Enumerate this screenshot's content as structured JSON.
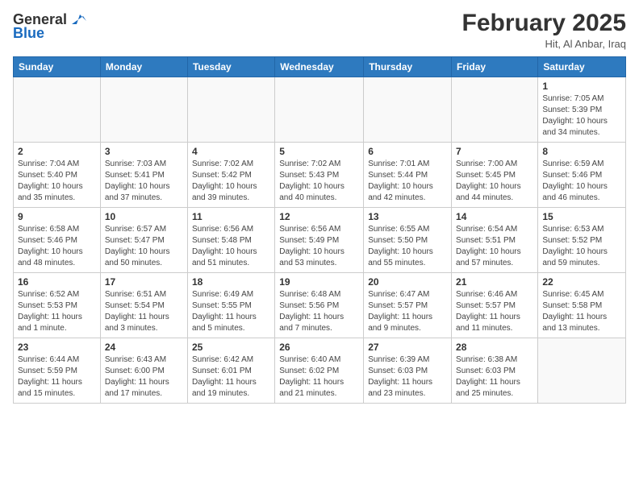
{
  "logo": {
    "general": "General",
    "blue": "Blue"
  },
  "header": {
    "month_year": "February 2025",
    "location": "Hit, Al Anbar, Iraq"
  },
  "weekdays": [
    "Sunday",
    "Monday",
    "Tuesday",
    "Wednesday",
    "Thursday",
    "Friday",
    "Saturday"
  ],
  "weeks": [
    [
      {
        "day": "",
        "info": ""
      },
      {
        "day": "",
        "info": ""
      },
      {
        "day": "",
        "info": ""
      },
      {
        "day": "",
        "info": ""
      },
      {
        "day": "",
        "info": ""
      },
      {
        "day": "",
        "info": ""
      },
      {
        "day": "1",
        "info": "Sunrise: 7:05 AM\nSunset: 5:39 PM\nDaylight: 10 hours and 34 minutes."
      }
    ],
    [
      {
        "day": "2",
        "info": "Sunrise: 7:04 AM\nSunset: 5:40 PM\nDaylight: 10 hours and 35 minutes."
      },
      {
        "day": "3",
        "info": "Sunrise: 7:03 AM\nSunset: 5:41 PM\nDaylight: 10 hours and 37 minutes."
      },
      {
        "day": "4",
        "info": "Sunrise: 7:02 AM\nSunset: 5:42 PM\nDaylight: 10 hours and 39 minutes."
      },
      {
        "day": "5",
        "info": "Sunrise: 7:02 AM\nSunset: 5:43 PM\nDaylight: 10 hours and 40 minutes."
      },
      {
        "day": "6",
        "info": "Sunrise: 7:01 AM\nSunset: 5:44 PM\nDaylight: 10 hours and 42 minutes."
      },
      {
        "day": "7",
        "info": "Sunrise: 7:00 AM\nSunset: 5:45 PM\nDaylight: 10 hours and 44 minutes."
      },
      {
        "day": "8",
        "info": "Sunrise: 6:59 AM\nSunset: 5:46 PM\nDaylight: 10 hours and 46 minutes."
      }
    ],
    [
      {
        "day": "9",
        "info": "Sunrise: 6:58 AM\nSunset: 5:46 PM\nDaylight: 10 hours and 48 minutes."
      },
      {
        "day": "10",
        "info": "Sunrise: 6:57 AM\nSunset: 5:47 PM\nDaylight: 10 hours and 50 minutes."
      },
      {
        "day": "11",
        "info": "Sunrise: 6:56 AM\nSunset: 5:48 PM\nDaylight: 10 hours and 51 minutes."
      },
      {
        "day": "12",
        "info": "Sunrise: 6:56 AM\nSunset: 5:49 PM\nDaylight: 10 hours and 53 minutes."
      },
      {
        "day": "13",
        "info": "Sunrise: 6:55 AM\nSunset: 5:50 PM\nDaylight: 10 hours and 55 minutes."
      },
      {
        "day": "14",
        "info": "Sunrise: 6:54 AM\nSunset: 5:51 PM\nDaylight: 10 hours and 57 minutes."
      },
      {
        "day": "15",
        "info": "Sunrise: 6:53 AM\nSunset: 5:52 PM\nDaylight: 10 hours and 59 minutes."
      }
    ],
    [
      {
        "day": "16",
        "info": "Sunrise: 6:52 AM\nSunset: 5:53 PM\nDaylight: 11 hours and 1 minute."
      },
      {
        "day": "17",
        "info": "Sunrise: 6:51 AM\nSunset: 5:54 PM\nDaylight: 11 hours and 3 minutes."
      },
      {
        "day": "18",
        "info": "Sunrise: 6:49 AM\nSunset: 5:55 PM\nDaylight: 11 hours and 5 minutes."
      },
      {
        "day": "19",
        "info": "Sunrise: 6:48 AM\nSunset: 5:56 PM\nDaylight: 11 hours and 7 minutes."
      },
      {
        "day": "20",
        "info": "Sunrise: 6:47 AM\nSunset: 5:57 PM\nDaylight: 11 hours and 9 minutes."
      },
      {
        "day": "21",
        "info": "Sunrise: 6:46 AM\nSunset: 5:57 PM\nDaylight: 11 hours and 11 minutes."
      },
      {
        "day": "22",
        "info": "Sunrise: 6:45 AM\nSunset: 5:58 PM\nDaylight: 11 hours and 13 minutes."
      }
    ],
    [
      {
        "day": "23",
        "info": "Sunrise: 6:44 AM\nSunset: 5:59 PM\nDaylight: 11 hours and 15 minutes."
      },
      {
        "day": "24",
        "info": "Sunrise: 6:43 AM\nSunset: 6:00 PM\nDaylight: 11 hours and 17 minutes."
      },
      {
        "day": "25",
        "info": "Sunrise: 6:42 AM\nSunset: 6:01 PM\nDaylight: 11 hours and 19 minutes."
      },
      {
        "day": "26",
        "info": "Sunrise: 6:40 AM\nSunset: 6:02 PM\nDaylight: 11 hours and 21 minutes."
      },
      {
        "day": "27",
        "info": "Sunrise: 6:39 AM\nSunset: 6:03 PM\nDaylight: 11 hours and 23 minutes."
      },
      {
        "day": "28",
        "info": "Sunrise: 6:38 AM\nSunset: 6:03 PM\nDaylight: 11 hours and 25 minutes."
      },
      {
        "day": "",
        "info": ""
      }
    ]
  ]
}
